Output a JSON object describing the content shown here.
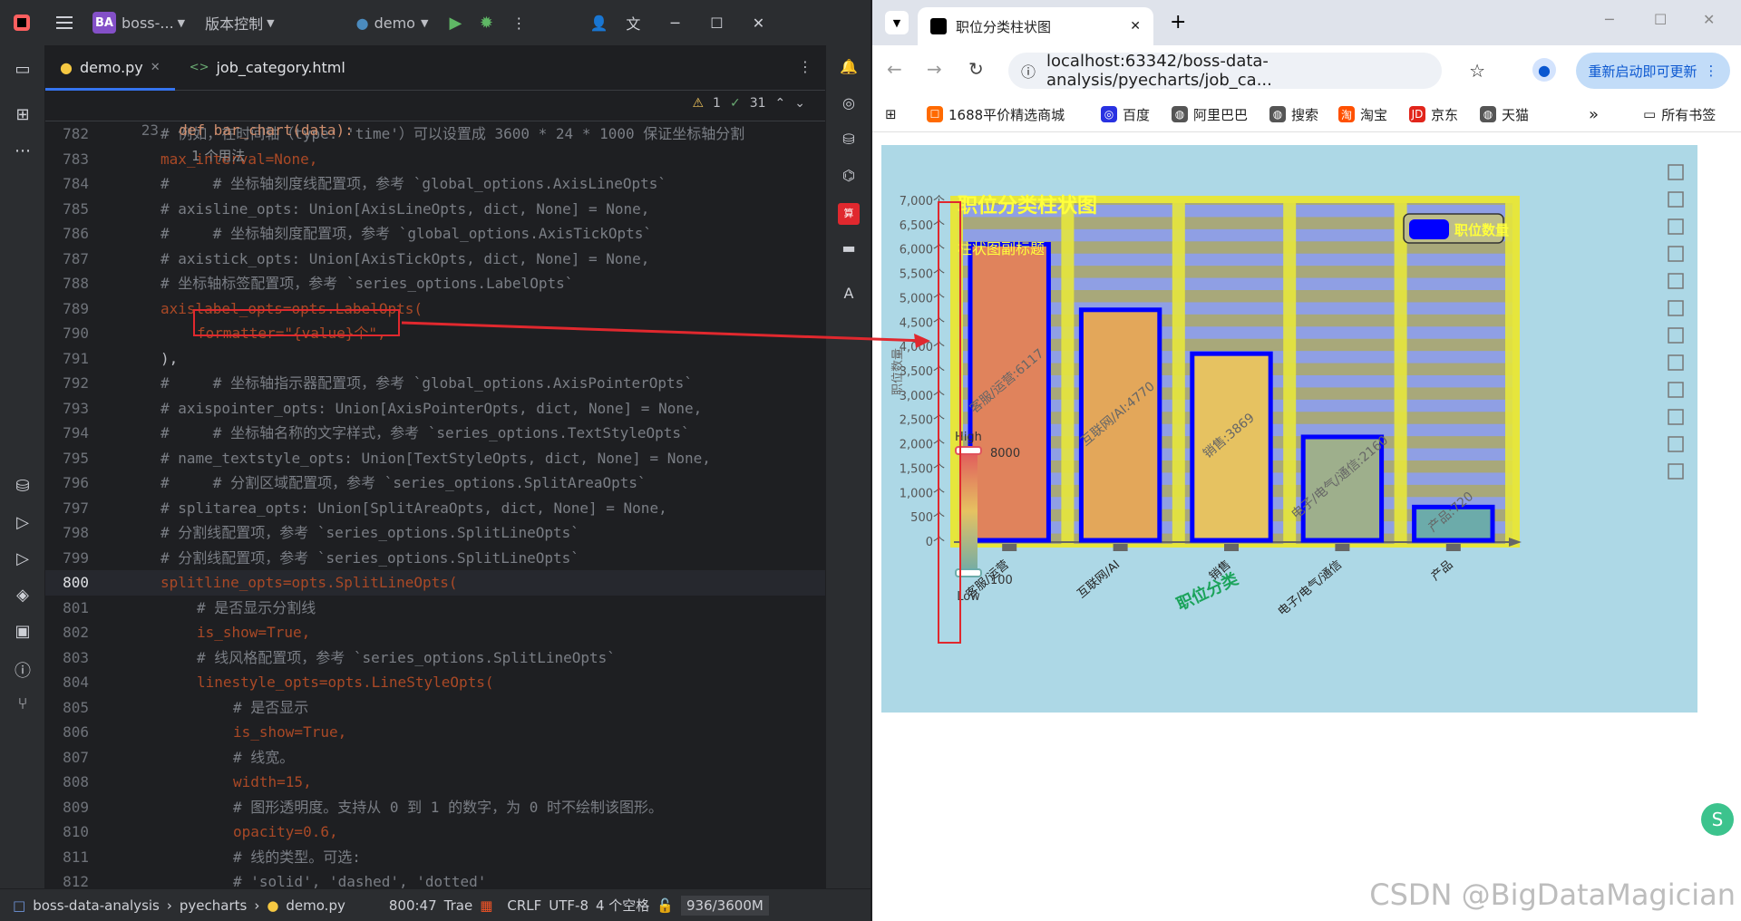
{
  "ide": {
    "project_badge": "BA",
    "project_name": "boss-...",
    "vcs_label": "版本控制",
    "run_config": "demo",
    "tabs": [
      {
        "label": "demo.py",
        "active": true
      },
      {
        "label": "job_category.html",
        "active": false
      }
    ],
    "sticky": {
      "line_no": "23",
      "code": "def bar_chart(data):",
      "usage_hint": "1 个用法",
      "warnings": "1",
      "weak_warnings": "31"
    },
    "lines": [
      {
        "n": "782",
        "text": "# 例如，在时间轴（type: 'time'）可以设置成 3600 * 24 * 1000 保证坐标轴分割",
        "type": "comment",
        "indent": 2
      },
      {
        "n": "783",
        "text": "max_interval=None,",
        "type": "param",
        "indent": 2
      },
      {
        "n": "784",
        "text": "#     # 坐标轴刻度线配置项，参考 `global_options.AxisLineOpts`",
        "type": "comment",
        "indent": 2
      },
      {
        "n": "785",
        "text": "# axisline_opts: Union[AxisLineOpts, dict, None] = None,",
        "type": "comment",
        "indent": 2
      },
      {
        "n": "786",
        "text": "#     # 坐标轴刻度配置项，参考 `global_options.AxisTickOpts`",
        "type": "comment",
        "indent": 2
      },
      {
        "n": "787",
        "text": "# axistick_opts: Union[AxisTickOpts, dict, None] = None,",
        "type": "comment",
        "indent": 2
      },
      {
        "n": "788",
        "text": "# 坐标轴标签配置项，参考 `series_options.LabelOpts`",
        "type": "comment",
        "indent": 2
      },
      {
        "n": "789",
        "text": "axislabel_opts=opts.LabelOpts(",
        "type": "param",
        "indent": 2
      },
      {
        "n": "790",
        "text": "formatter=\"{value}个\",",
        "type": "param-str",
        "indent": 3
      },
      {
        "n": "791",
        "text": "),",
        "type": "plain",
        "indent": 2
      },
      {
        "n": "792",
        "text": "#     # 坐标轴指示器配置项，参考 `global_options.AxisPointerOpts`",
        "type": "comment",
        "indent": 2
      },
      {
        "n": "793",
        "text": "# axispointer_opts: Union[AxisPointerOpts, dict, None] = None,",
        "type": "comment",
        "indent": 2
      },
      {
        "n": "794",
        "text": "#     # 坐标轴名称的文字样式，参考 `series_options.TextStyleOpts`",
        "type": "comment",
        "indent": 2
      },
      {
        "n": "795",
        "text": "# name_textstyle_opts: Union[TextStyleOpts, dict, None] = None,",
        "type": "comment",
        "indent": 2
      },
      {
        "n": "796",
        "text": "#     # 分割区域配置项，参考 `series_options.SplitAreaOpts`",
        "type": "comment",
        "indent": 2
      },
      {
        "n": "797",
        "text": "# splitarea_opts: Union[SplitAreaOpts, dict, None] = None,",
        "type": "comment",
        "indent": 2
      },
      {
        "n": "798",
        "text": "# 分割线配置项，参考 `series_options.SplitLineOpts`",
        "type": "comment",
        "indent": 2
      },
      {
        "n": "799",
        "text": "# 分割线配置项，参考 `series_options.SplitLineOpts`",
        "type": "comment",
        "indent": 2
      },
      {
        "n": "800",
        "text": "splitline_opts=opts.SplitLineOpts(",
        "type": "param",
        "indent": 2
      },
      {
        "n": "801",
        "text": "# 是否显示分割线",
        "type": "comment",
        "indent": 3
      },
      {
        "n": "802",
        "text": "is_show=True,",
        "type": "param-kw",
        "indent": 3
      },
      {
        "n": "803",
        "text": "# 线风格配置项，参考 `series_options.SplitLineOpts`",
        "type": "comment",
        "indent": 3
      },
      {
        "n": "804",
        "text": "linestyle_opts=opts.LineStyleOpts(",
        "type": "param",
        "indent": 3
      },
      {
        "n": "805",
        "text": "# 是否显示",
        "type": "comment",
        "indent": 4
      },
      {
        "n": "806",
        "text": "is_show=True,",
        "type": "param-kw",
        "indent": 4
      },
      {
        "n": "807",
        "text": "# 线宽。",
        "type": "comment",
        "indent": 4
      },
      {
        "n": "808",
        "text": "width=15,",
        "type": "param-num",
        "indent": 4
      },
      {
        "n": "809",
        "text": "# 图形透明度。支持从 0 到 1 的数字，为 0 时不绘制该图形。",
        "type": "comment",
        "indent": 4
      },
      {
        "n": "810",
        "text": "opacity=0.6,",
        "type": "param-num",
        "indent": 4
      },
      {
        "n": "811",
        "text": "# 线的类型。可选:",
        "type": "comment",
        "indent": 4
      },
      {
        "n": "812",
        "text": "# 'solid', 'dashed', 'dotted'",
        "type": "comment",
        "indent": 4
      }
    ],
    "status": {
      "project": "boss-data-analysis",
      "folder": "pyecharts",
      "file": "demo.py",
      "position": "800:47",
      "plugin": "Trae",
      "line_sep": "CRLF",
      "encoding": "UTF-8",
      "indent": "4 个空格",
      "memory": "936/3600M"
    }
  },
  "browser": {
    "tab_title": "职位分类柱状图",
    "url": "localhost:63342/boss-data-analysis/pyecharts/job_ca...",
    "update_label": "重新启动即可更新",
    "bookmarks": [
      "1688平价精选商城",
      "百度",
      "阿里巴巴",
      "搜索",
      "淘宝",
      "京东",
      "天猫"
    ],
    "all_bookmarks": "所有书签"
  },
  "chart_data": {
    "type": "bar",
    "title": "职位分类柱状图",
    "subtitle": "柱状图副标题",
    "xlabel": "职位分类",
    "ylabel": "职位数量",
    "categories": [
      "客服/运营",
      "互联网/AI",
      "销售",
      "电子/电气/通信",
      "产品"
    ],
    "series": [
      {
        "name": "职位数量",
        "values": [
          6117,
          4770,
          3869,
          2160,
          720
        ]
      }
    ],
    "data_labels": [
      "客服/运营:6117",
      "互联网/AI:4770",
      "销售:3869",
      "电子/电气/通信:2160",
      "产品:720"
    ],
    "ylim": [
      0,
      7000
    ],
    "y_ticks": [
      "0个",
      "500个",
      "1,000个",
      "1,500个",
      "2,000个",
      "2,500个",
      "3,000个",
      "3,500个",
      "4,000个",
      "4,500个",
      "5,000个",
      "5,500个",
      "6,000个",
      "6,500个",
      "7,000个"
    ],
    "visual_map": {
      "high_label": "High",
      "low_label": "Low",
      "max": "8000",
      "min": "100"
    },
    "legend_position": "top-right",
    "colors": {
      "background": "#add8e6",
      "bar_border": "#0000ff",
      "split_line": "#e6e63c"
    }
  },
  "watermark": "CSDN @BigDataMagician"
}
